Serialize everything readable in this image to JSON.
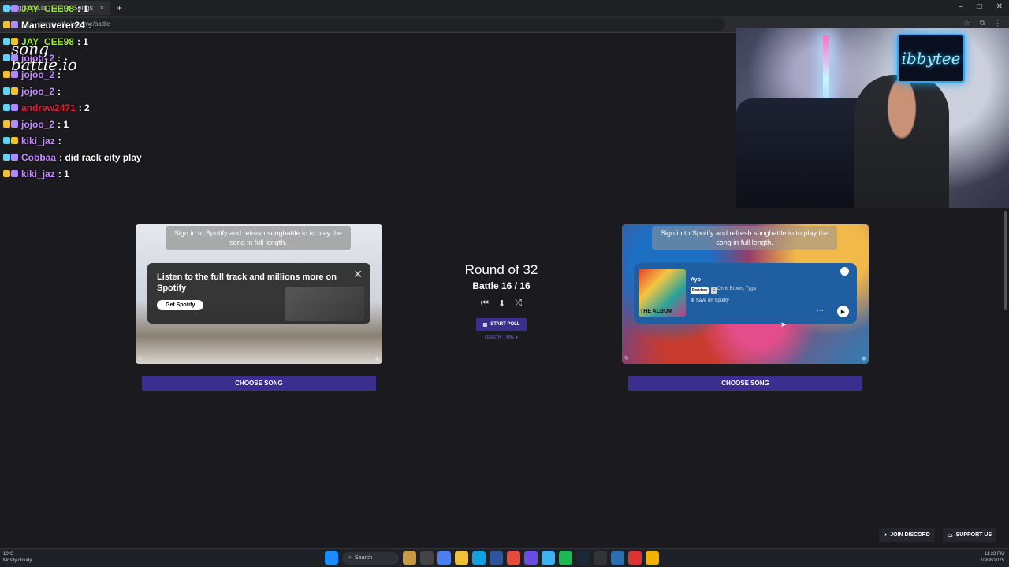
{
  "browser": {
    "tab_title": "songbattle.io - Battle Songs",
    "address": "songbattle.io/game/battle"
  },
  "chat": [
    {
      "user": "JAY_CEE98",
      "user_color": "#9be43a",
      "message": ": 1"
    },
    {
      "user": "Maneuverer24",
      "user_color": "#ffffff",
      "message": ":"
    },
    {
      "user": "JAY_CEE98",
      "user_color": "#9be43a",
      "message": ": 1"
    },
    {
      "user": "jojoo_2",
      "user_color": "#c58cff",
      "message": ":"
    },
    {
      "user": "jojoo_2",
      "user_color": "#c58cff",
      "message": ":"
    },
    {
      "user": "jojoo_2",
      "user_color": "#c58cff",
      "message": ":"
    },
    {
      "user": "andrew2471",
      "user_color": "#e1203c",
      "message": ": 2"
    },
    {
      "user": "jojoo_2",
      "user_color": "#c58cff",
      "message": ": 1"
    },
    {
      "user": "kiki_jaz",
      "user_color": "#c58cff",
      "message": ":"
    },
    {
      "user": "Cobbaa",
      "user_color": "#c58cff",
      "message": ": did rack city play"
    },
    {
      "user": "kiki_jaz",
      "user_color": "#c58cff",
      "message": ": 1"
    }
  ],
  "overlay_logo": {
    "line1": "song",
    "line2": "battle.io"
  },
  "webcam": {
    "neon_sign": "ibbytee"
  },
  "left_card": {
    "signin_notice": "Sign in to Spotify and refresh songbattle.io to play the song in full length.",
    "promo_title": "Listen to the full track and millions more on Spotify",
    "promo_button": "Get Spotify",
    "choose_label": "CHOOSE SONG"
  },
  "right_card": {
    "signin_notice": "Sign in to Spotify and refresh songbattle.io to play the song in full length.",
    "track_title": "Ayo",
    "preview_tag": "Preview",
    "explicit_tag": "E",
    "artists": "Chris Brown, Tyga",
    "save_label": "Save on Spotify",
    "album_text": "THE ALBUM",
    "choose_label": "CHOOSE SONG"
  },
  "center": {
    "round": "Round of 32",
    "battle": "Battle 16 / 16",
    "start_poll": "START POLL",
    "length": "LENGTH: 1 MIN. ▾"
  },
  "footer": {
    "discord": "JOIN DISCORD",
    "support": "SUPPORT US"
  },
  "taskbar": {
    "temp": "10°C",
    "weather": "Mostly cloudy",
    "search": "Search",
    "time": "11:22 PM",
    "date": "10/08/2025"
  },
  "colors": {
    "accent": "#3a2f8f",
    "background": "#1b1b1f",
    "spotify_blue": "#1f5ea0"
  }
}
